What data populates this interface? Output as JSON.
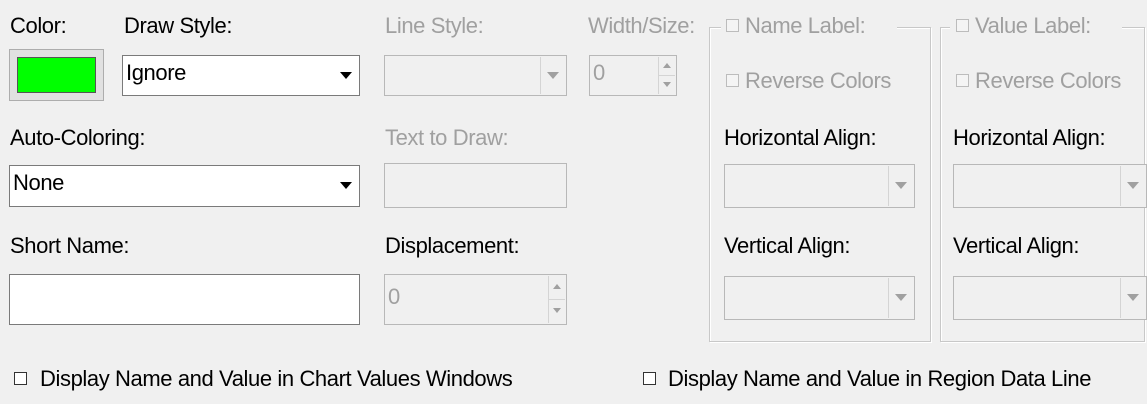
{
  "color": {
    "label": "Color:",
    "swatch": "#00ff00"
  },
  "draw_style": {
    "label": "Draw Style:",
    "value": "Ignore"
  },
  "line_style": {
    "label": "Line Style:",
    "value": ""
  },
  "width_size": {
    "label": "Width/Size:",
    "value": "0"
  },
  "auto_coloring": {
    "label": "Auto-Coloring:",
    "value": "None"
  },
  "text_to_draw": {
    "label": "Text to Draw:",
    "value": ""
  },
  "short_name": {
    "label": "Short Name:",
    "value": ""
  },
  "displacement": {
    "label": "Displacement:",
    "value": "0"
  },
  "name_label_group": {
    "title": "Name Label:",
    "reverse_colors": "Reverse Colors",
    "horizontal_align_label": "Horizontal Align:",
    "vertical_align_label": "Vertical Align:"
  },
  "value_label_group": {
    "title": "Value Label:",
    "reverse_colors": "Reverse Colors",
    "horizontal_align_label": "Horizontal Align:",
    "vertical_align_label": "Vertical Align:"
  },
  "bottom": {
    "chart_values_label": "Display Name and Value in Chart Values Windows",
    "region_data_label": "Display Name and Value in Region Data Line"
  },
  "icons": {
    "dropdown": "chevron-down-icon",
    "spinner": "spin-arrows-icon"
  }
}
